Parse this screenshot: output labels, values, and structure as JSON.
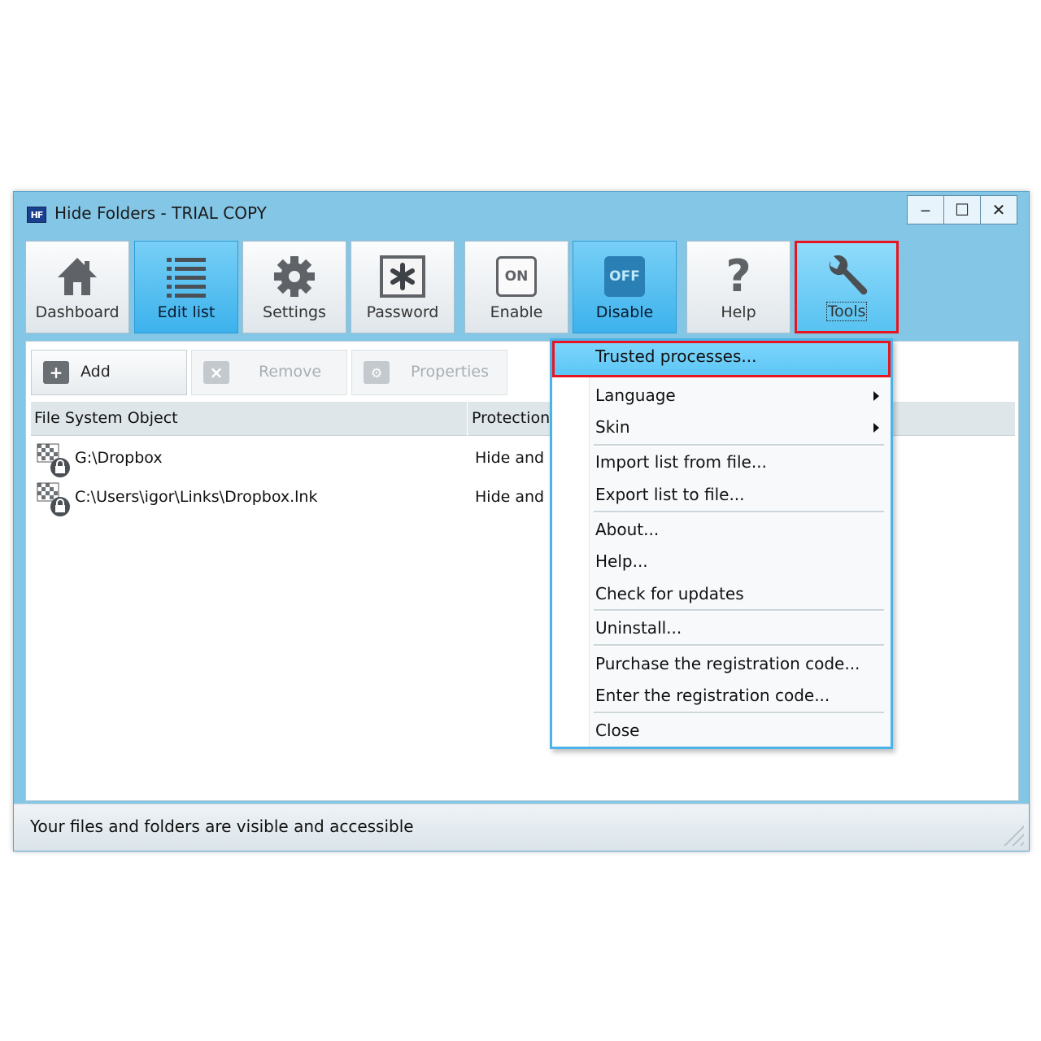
{
  "window": {
    "icon_text": "HF",
    "title": "Hide Folders - TRIAL COPY",
    "controls": {
      "minimize": "‒",
      "maximize": "☐",
      "close": "✕"
    }
  },
  "toolbar": {
    "dashboard": "Dashboard",
    "edit_list": "Edit list",
    "settings": "Settings",
    "password": "Password",
    "enable": "Enable",
    "enable_badge": "ON",
    "disable": "Disable",
    "disable_badge": "OFF",
    "help": "Help",
    "tools": "Tools"
  },
  "actions": {
    "add": "Add",
    "remove": "Remove",
    "properties": "Properties"
  },
  "list": {
    "columns": {
      "object": "File System Object",
      "protection": "Protection"
    },
    "rows": [
      {
        "path": "G:\\Dropbox",
        "protection": "Hide and Lock"
      },
      {
        "path": "C:\\Users\\igor\\Links\\Dropbox.lnk",
        "protection": "Hide and Lock"
      }
    ]
  },
  "status": {
    "text": "Your files and folders are visible and accessible"
  },
  "tools_menu": {
    "items": [
      "Trusted processes...",
      "Language",
      "Skin",
      "Import list from file...",
      "Export list to file...",
      "About...",
      "Help...",
      "Check for updates",
      "Uninstall...",
      "Purchase the registration code...",
      "Enter the registration code...",
      "Close"
    ]
  },
  "colors": {
    "window_frame": "#84c6e6",
    "active_button": "#3cb2ec",
    "highlight_outline": "#e8141e",
    "menu_border": "#4ab3ea"
  }
}
